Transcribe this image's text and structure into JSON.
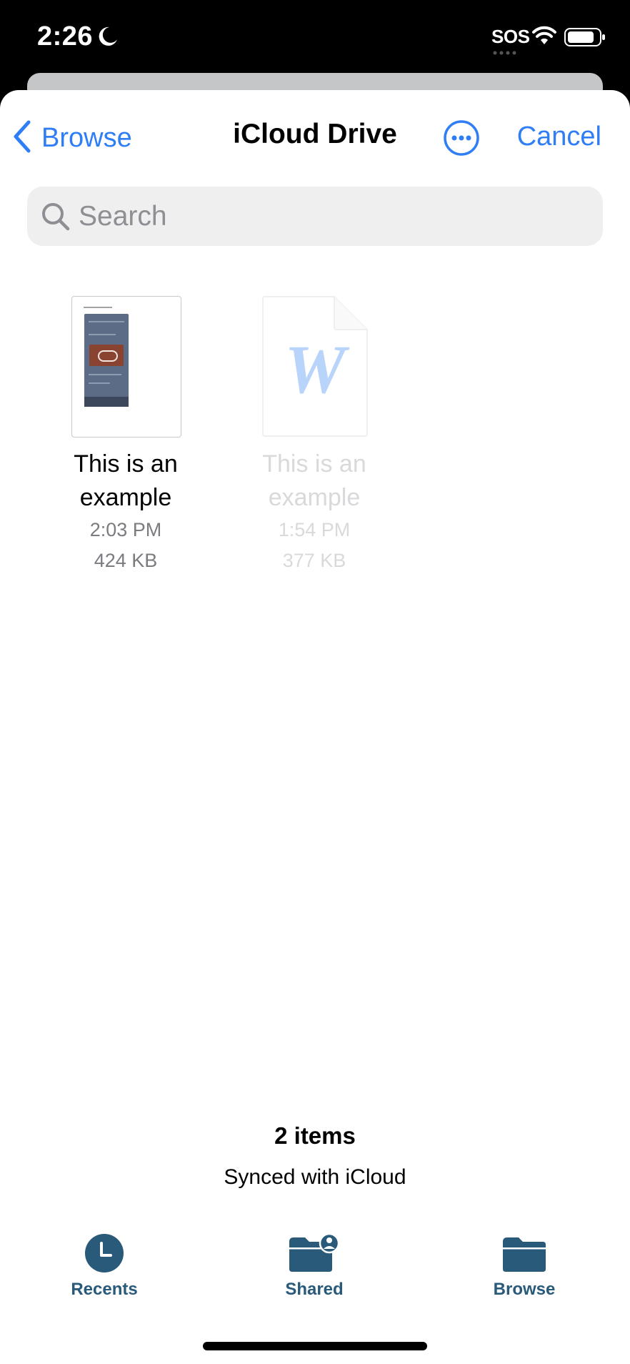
{
  "status_bar": {
    "time": "2:26",
    "carrier": "SOS",
    "icons": [
      "moon-icon",
      "wifi-icon",
      "battery-icon"
    ]
  },
  "nav": {
    "back_label": "Browse",
    "title": "iCloud Drive",
    "cancel_label": "Cancel",
    "more_icon": "ellipsis-circle-icon"
  },
  "search": {
    "placeholder": "Search",
    "value": ""
  },
  "files": [
    {
      "name": "This is an example",
      "time": "2:03 PM",
      "size": "424 KB",
      "type": "image-preview",
      "disabled": false
    },
    {
      "name": "This is an example",
      "time": "1:54 PM",
      "size": "377 KB",
      "type": "word-doc",
      "disabled": true
    }
  ],
  "footer": {
    "count": "2 items",
    "sync_status": "Synced with iCloud"
  },
  "tabs": [
    {
      "label": "Recents",
      "icon": "clock-icon"
    },
    {
      "label": "Shared",
      "icon": "shared-folder-icon"
    },
    {
      "label": "Browse",
      "icon": "folder-icon"
    }
  ],
  "colors": {
    "accent": "#2f7ef5",
    "tab_tint": "#2a5a7a",
    "search_bg": "#efeff0"
  }
}
